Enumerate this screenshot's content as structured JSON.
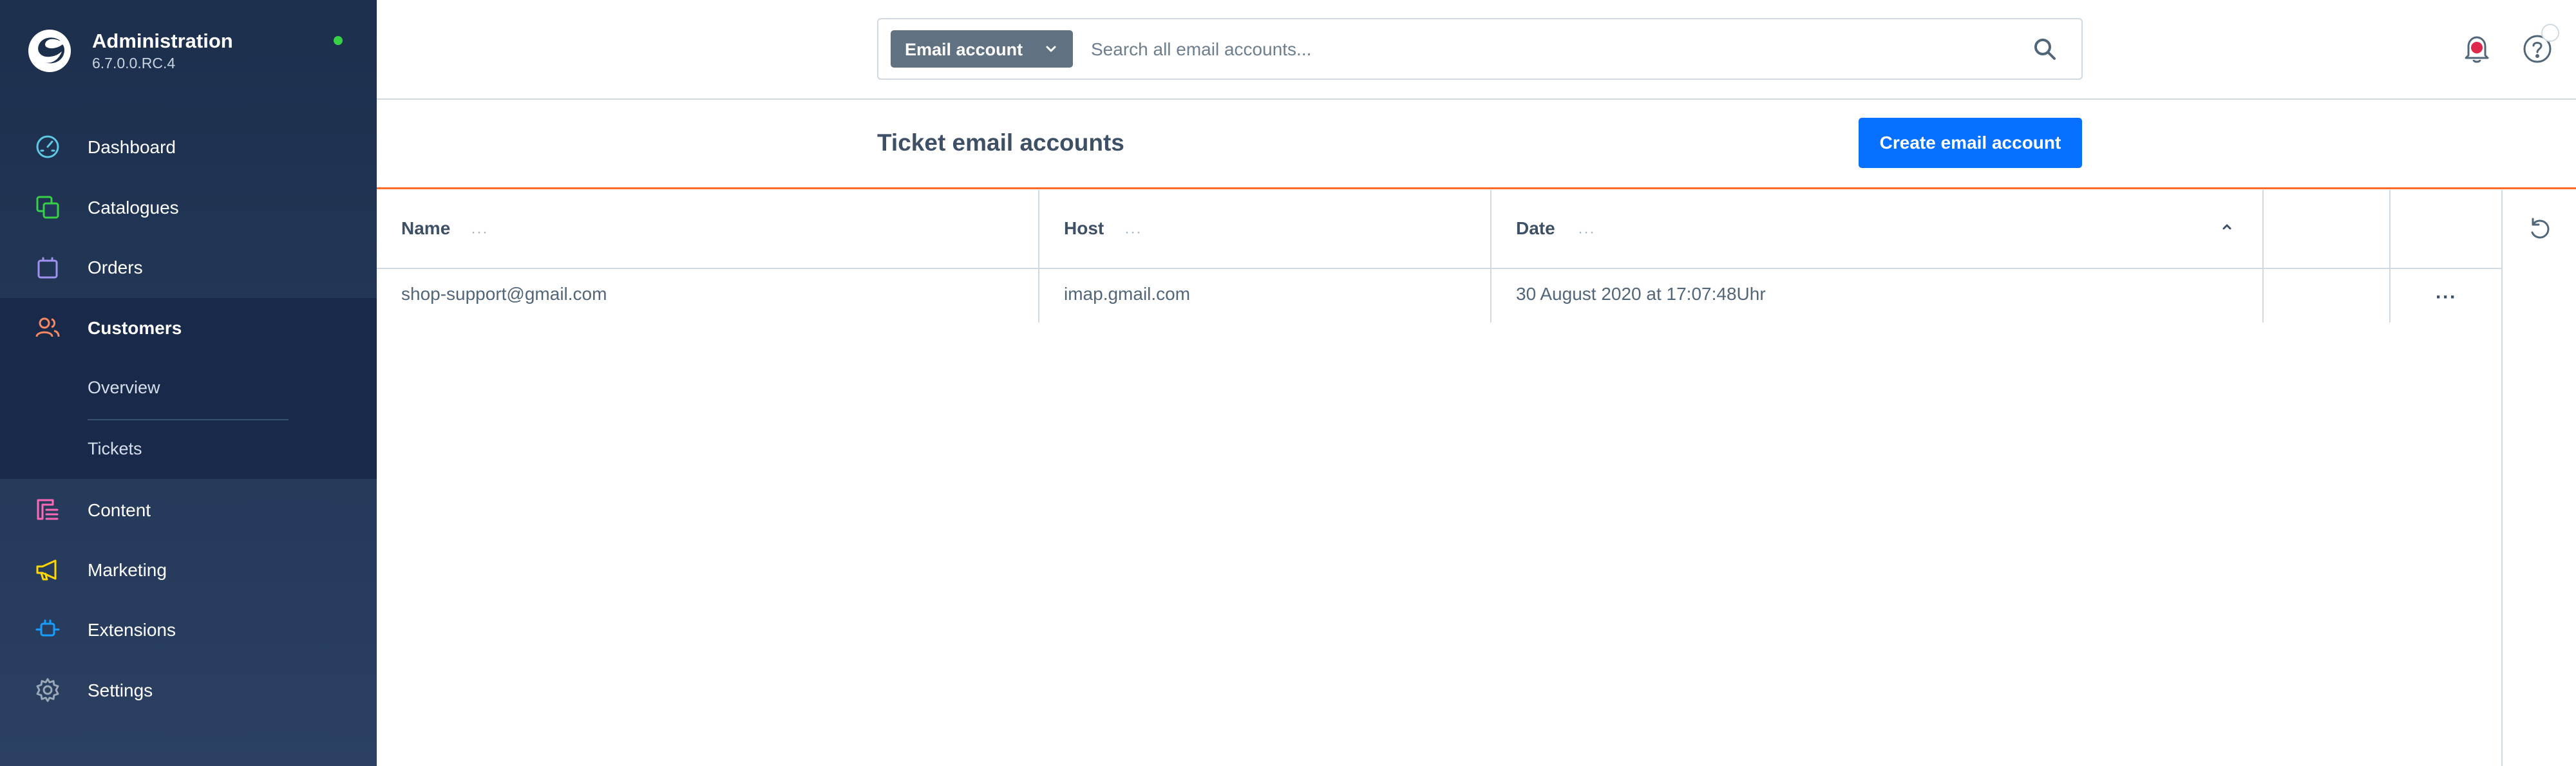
{
  "sidebar": {
    "title": "Administration",
    "version": "6.7.0.0.RC.4",
    "items": [
      {
        "label": "Dashboard",
        "icon": "dashboard-icon"
      },
      {
        "label": "Catalogues",
        "icon": "catalogues-icon"
      },
      {
        "label": "Orders",
        "icon": "orders-icon"
      },
      {
        "label": "Customers",
        "icon": "customers-icon",
        "active": true,
        "children": [
          {
            "label": "Overview"
          },
          {
            "label": "Tickets"
          }
        ]
      },
      {
        "label": "Content",
        "icon": "content-icon"
      },
      {
        "label": "Marketing",
        "icon": "marketing-icon"
      },
      {
        "label": "Extensions",
        "icon": "extensions-icon"
      },
      {
        "label": "Settings",
        "icon": "settings-icon"
      }
    ]
  },
  "search": {
    "type_label": "Email account",
    "placeholder": "Search all email accounts..."
  },
  "page": {
    "title": "Ticket email accounts",
    "create_label": "Create email account"
  },
  "table": {
    "columns": [
      {
        "label": "Name"
      },
      {
        "label": "Host"
      },
      {
        "label": "Date"
      }
    ],
    "rows": [
      {
        "name": "shop-support@gmail.com",
        "host": "imap.gmail.com",
        "date": "30 August 2020 at 17:07:48Uhr"
      }
    ],
    "column_menu_glyph": "···",
    "row_actions_glyph": "···"
  },
  "colors": {
    "sidebar_bg": "#1c2f4d",
    "accent": "#0870ff",
    "smartbar_border": "#ff6b27",
    "status_online": "#37d046",
    "dashboard": "#5ec8e5",
    "catalogues": "#37d046",
    "orders": "#a092f0",
    "customers": "#f88962",
    "content": "#ff68b4",
    "marketing": "#ffd700",
    "extensions": "#189eff",
    "settings": "#9aa8b5"
  }
}
